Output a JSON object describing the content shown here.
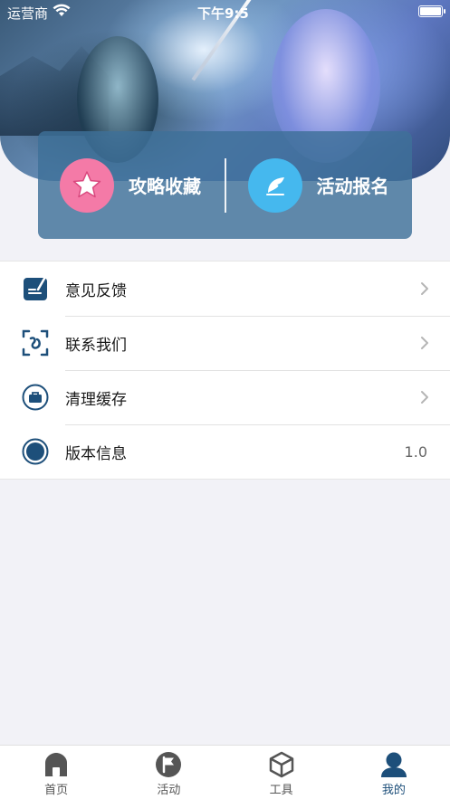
{
  "status_bar": {
    "carrier": "运营商",
    "time": "下午9:5"
  },
  "actions": [
    {
      "label": "攻略收藏",
      "icon": "star-icon",
      "color": "#f47aa7"
    },
    {
      "label": "活动报名",
      "icon": "feather-pen-icon",
      "color": "#45b8ee"
    }
  ],
  "menu": {
    "items": [
      {
        "label": "意见反馈",
        "icon": "feedback-edit-icon",
        "accessory": "chevron"
      },
      {
        "label": "联系我们",
        "icon": "contact-scan-icon",
        "accessory": "chevron"
      },
      {
        "label": "清理缓存",
        "icon": "clear-cache-icon",
        "accessory": "chevron"
      },
      {
        "label": "版本信息",
        "icon": "version-info-icon",
        "value": "1.0"
      }
    ]
  },
  "tabbar": {
    "items": [
      {
        "label": "首页",
        "icon": "home-icon",
        "active": false
      },
      {
        "label": "活动",
        "icon": "flag-icon",
        "active": false
      },
      {
        "label": "工具",
        "icon": "cube-icon",
        "active": false
      },
      {
        "label": "我的",
        "icon": "user-icon",
        "active": true
      }
    ]
  },
  "colors": {
    "accent": "#1d4f7a",
    "card_bg": "#3e7098",
    "pink": "#f47aa7",
    "sky": "#45b8ee"
  }
}
